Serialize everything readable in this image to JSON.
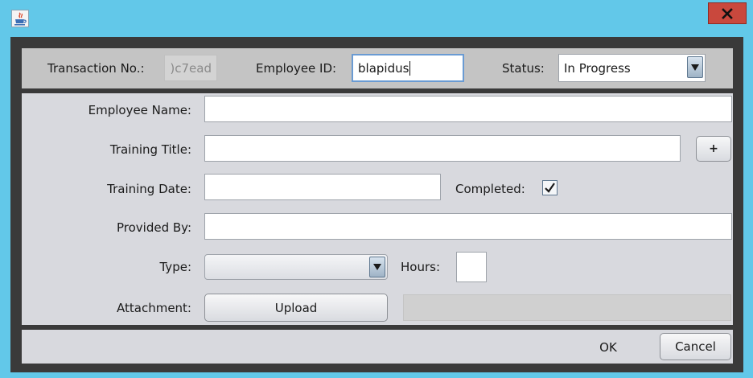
{
  "header": {
    "transaction_label": "Transaction No.:",
    "transaction_value": ")c7ead",
    "employee_id_label": "Employee ID:",
    "employee_id_value": "blapidus",
    "status_label": "Status:",
    "status_value": "In Progress"
  },
  "form": {
    "employee_name_label": "Employee Name:",
    "employee_name_value": "",
    "training_title_label": "Training Title:",
    "training_title_value": "",
    "add_title_button": "+",
    "training_date_label": "Training Date:",
    "training_date_value": "",
    "completed_label": "Completed:",
    "completed_checked": true,
    "provided_by_label": "Provided By:",
    "provided_by_value": "",
    "type_label": "Type:",
    "type_value": "",
    "hours_label": "Hours:",
    "hours_value": "",
    "attachment_label": "Attachment:",
    "upload_button": "Upload",
    "attachment_path": ""
  },
  "footer": {
    "ok_button": "OK",
    "cancel_button": "Cancel"
  },
  "icons": {
    "app": "java-app-icon",
    "close": "close-icon",
    "dropdown": "chevron-down-icon",
    "check": "checkmark-icon"
  },
  "colors": {
    "titlebar": "#62c8e9",
    "close_button": "#c9483d",
    "frame": "#3a3a3a",
    "header_panel": "#c4c4c4",
    "form_panel": "#d8d9de",
    "focus_border": "#6a9bd3"
  }
}
